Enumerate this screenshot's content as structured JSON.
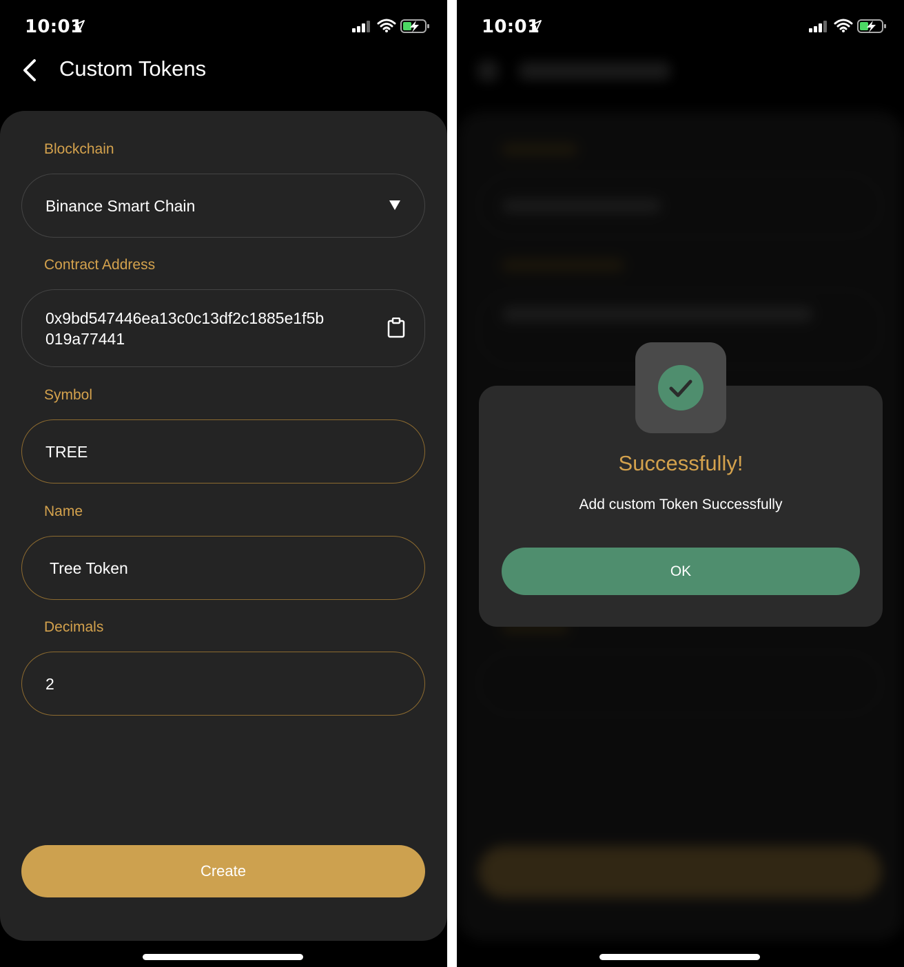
{
  "left_screen": {
    "status": {
      "time": "10:01"
    },
    "header": {
      "title": "Custom Tokens"
    },
    "form": {
      "blockchain": {
        "label": "Blockchain",
        "value": "Binance Smart Chain"
      },
      "contract_address": {
        "label": "Contract Address",
        "value_line1": "0x9bd547446ea13c0c13df2c1885e1f5b",
        "value_line2": "019a77441"
      },
      "symbol": {
        "label": "Symbol",
        "value": "TREE"
      },
      "name": {
        "label": "Name",
        "value": "Tree Token"
      },
      "decimals": {
        "label": "Decimals",
        "value": "2"
      }
    },
    "create_button": "Create"
  },
  "right_screen": {
    "status": {
      "time": "10:01"
    },
    "dialog": {
      "title": "Successfully!",
      "message": "Add custom Token Successfully",
      "ok_button": "OK"
    }
  },
  "colors": {
    "accent_gold": "#cda14f",
    "label_gold": "#d4a24d",
    "success_green": "#4f8e6e",
    "card_background": "#242424"
  },
  "icons": [
    "location-arrow-icon",
    "signal-icon",
    "wifi-icon",
    "battery-charging-icon",
    "back-chevron-icon",
    "dropdown-triangle-icon",
    "clipboard-icon",
    "check-circle-icon"
  ]
}
